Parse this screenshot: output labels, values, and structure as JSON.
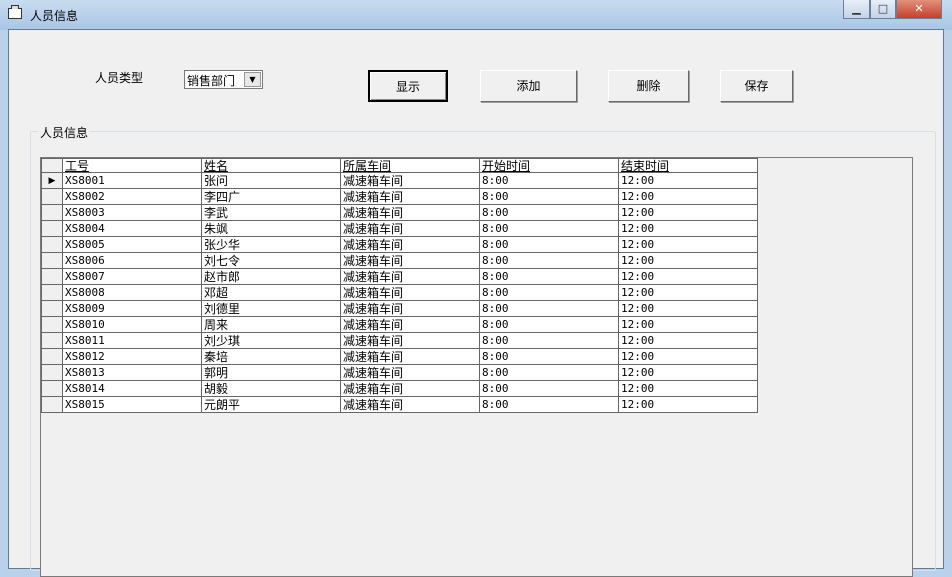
{
  "window": {
    "title": "人员信息",
    "minimize": "▁",
    "maximize": "□",
    "close": "✕"
  },
  "form": {
    "type_label": "人员类型",
    "type_value": "销售部门",
    "buttons": {
      "show": "显示",
      "add": "添加",
      "delete": "删除",
      "save": "保存"
    },
    "group_label": "人员信息"
  },
  "grid": {
    "columns": [
      "工号",
      "姓名",
      "所属车间",
      "开始时间",
      "结束时间"
    ],
    "current_row_marker": "▶",
    "rows": [
      [
        "XS8001",
        "张问",
        "减速箱车间",
        "8:00",
        "12:00"
      ],
      [
        "XS8002",
        "李四广",
        "减速箱车间",
        "8:00",
        "12:00"
      ],
      [
        "XS8003",
        "李武",
        "减速箱车间",
        "8:00",
        "12:00"
      ],
      [
        "XS8004",
        "朱飒",
        "减速箱车间",
        "8:00",
        "12:00"
      ],
      [
        "XS8005",
        "张少华",
        "减速箱车间",
        "8:00",
        "12:00"
      ],
      [
        "XS8006",
        "刘七令",
        "减速箱车间",
        "8:00",
        "12:00"
      ],
      [
        "XS8007",
        "赵市郎",
        "减速箱车间",
        "8:00",
        "12:00"
      ],
      [
        "XS8008",
        "邓超",
        "减速箱车间",
        "8:00",
        "12:00"
      ],
      [
        "XS8009",
        "刘德里",
        "减速箱车间",
        "8:00",
        "12:00"
      ],
      [
        "XS8010",
        "周来",
        "减速箱车间",
        "8:00",
        "12:00"
      ],
      [
        "XS8011",
        "刘少琪",
        "减速箱车间",
        "8:00",
        "12:00"
      ],
      [
        "XS8012",
        "秦培",
        "减速箱车间",
        "8:00",
        "12:00"
      ],
      [
        "XS8013",
        "郭明",
        "减速箱车间",
        "8:00",
        "12:00"
      ],
      [
        "XS8014",
        "胡毅",
        "减速箱车间",
        "8:00",
        "12:00"
      ],
      [
        "XS8015",
        "元朗平",
        "减速箱车间",
        "8:00",
        "12:00"
      ]
    ]
  }
}
